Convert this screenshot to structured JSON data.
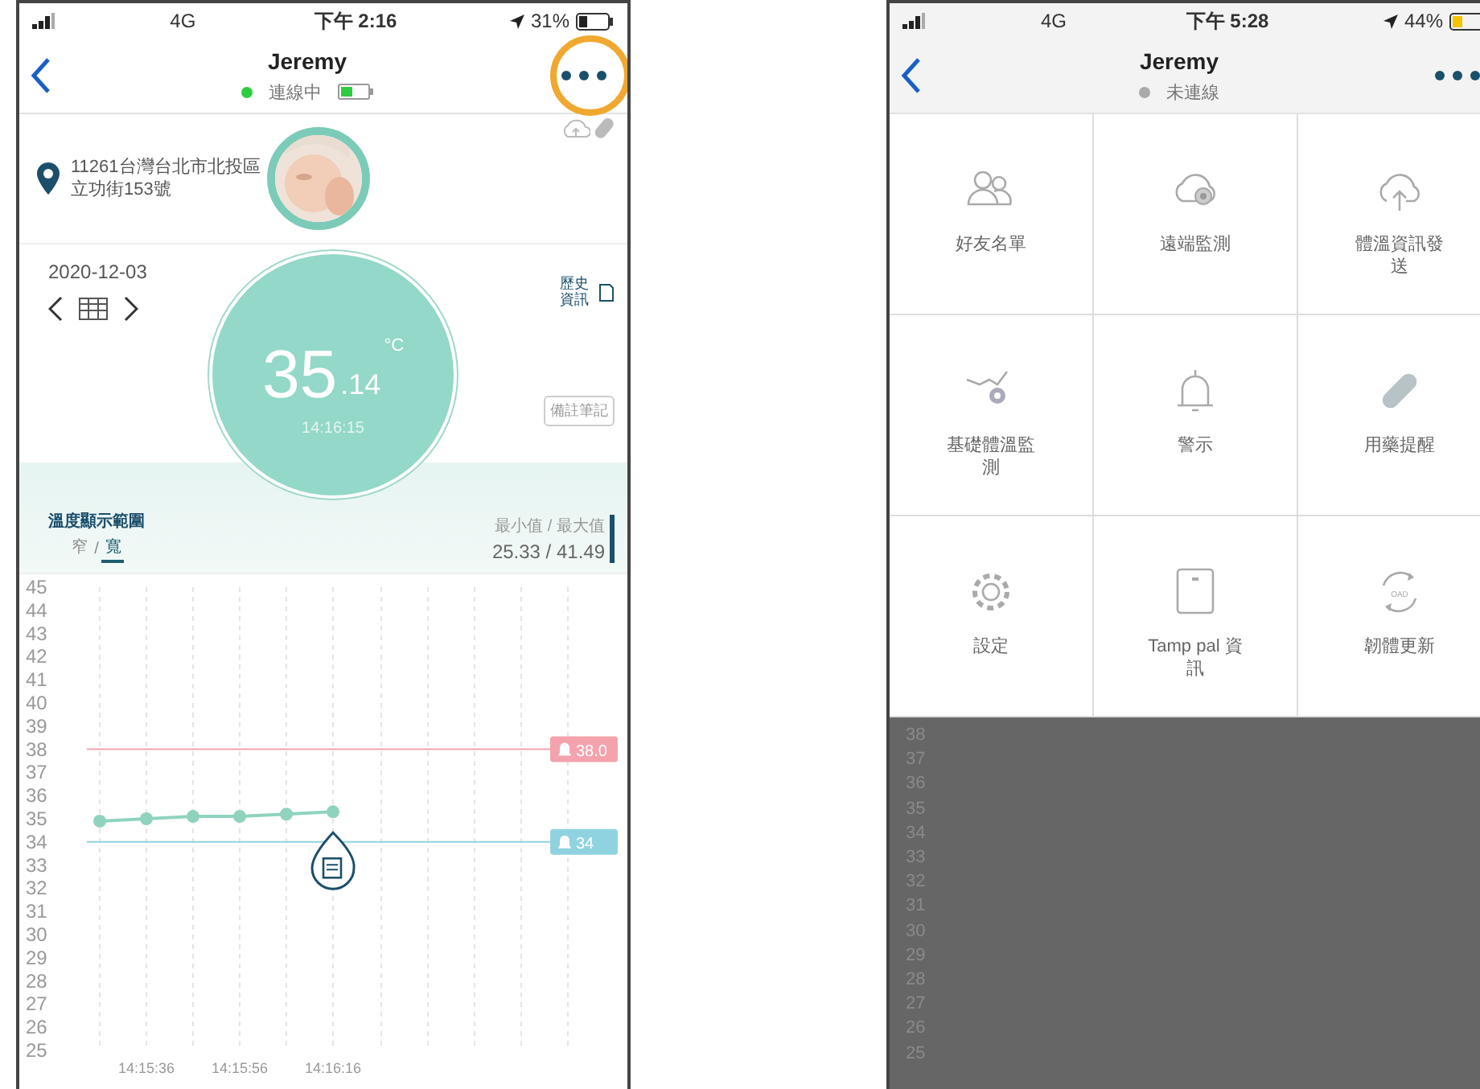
{
  "left_screen": {
    "status_bar": {
      "network": "4G",
      "time": "下午 2:16",
      "battery": "31%"
    },
    "nav": {
      "title": "Jeremy",
      "status": "連線中",
      "connected": true,
      "menu_highlighted": true
    },
    "address": "11261台灣台北市北投區立功街153號",
    "date": "2020-12-03",
    "history_label": "歷史資訊",
    "note_button": "備註筆記",
    "temperature": {
      "integer": "35",
      "decimal": ".14",
      "unit": "°C",
      "time": "14:16:15"
    },
    "range_toggle": {
      "label": "溫度顯示範圍",
      "separator": "/",
      "options": [
        {
          "label": "窄",
          "selected": false
        },
        {
          "label": "寬",
          "selected": true
        }
      ]
    },
    "min_max": {
      "label": "最小值 / 最大值",
      "value": "25.33 / 41.49"
    },
    "chart_data": {
      "type": "line",
      "categories": [
        null,
        "14:15:36",
        null,
        "14:15:56",
        null,
        "14:16:16"
      ],
      "ylim": [
        25,
        45
      ],
      "yticks": [
        45,
        44,
        43,
        42,
        41,
        40,
        39,
        38,
        37,
        36,
        35,
        34,
        33,
        32,
        31,
        30,
        29,
        28,
        27,
        26,
        25
      ],
      "grid": true,
      "series": [
        {
          "color": "#8fd3bf",
          "marker": true,
          "values": [
            34.9,
            35.0,
            35.1,
            35.1,
            35.2,
            35.3
          ]
        }
      ],
      "ref_lines": [
        {
          "axis": "y",
          "value": 38,
          "label": "38.0",
          "color": "#f4a3ad"
        },
        {
          "axis": "y",
          "value": 34,
          "label": "34",
          "color": "#8fd3e0"
        }
      ]
    }
  },
  "right_screen": {
    "status_bar": {
      "network": "4G",
      "time": "下午 5:28",
      "battery": "44%"
    },
    "nav": {
      "title": "Jeremy",
      "status": "未連線",
      "connected": false
    },
    "menu_items": [
      "好友名單",
      "遠端監測",
      "體溫資訊發送",
      "基礎體溫監測",
      "警示",
      "用藥提醒",
      "設定",
      "Tamp pal 資訊",
      "韌體更新"
    ],
    "icon_caption": "OAD",
    "dimmed_axis_labels": [
      "38",
      "37",
      "36",
      "35",
      "34",
      "33",
      "32",
      "31",
      "30",
      "29",
      "28",
      "27",
      "26",
      "25"
    ]
  }
}
